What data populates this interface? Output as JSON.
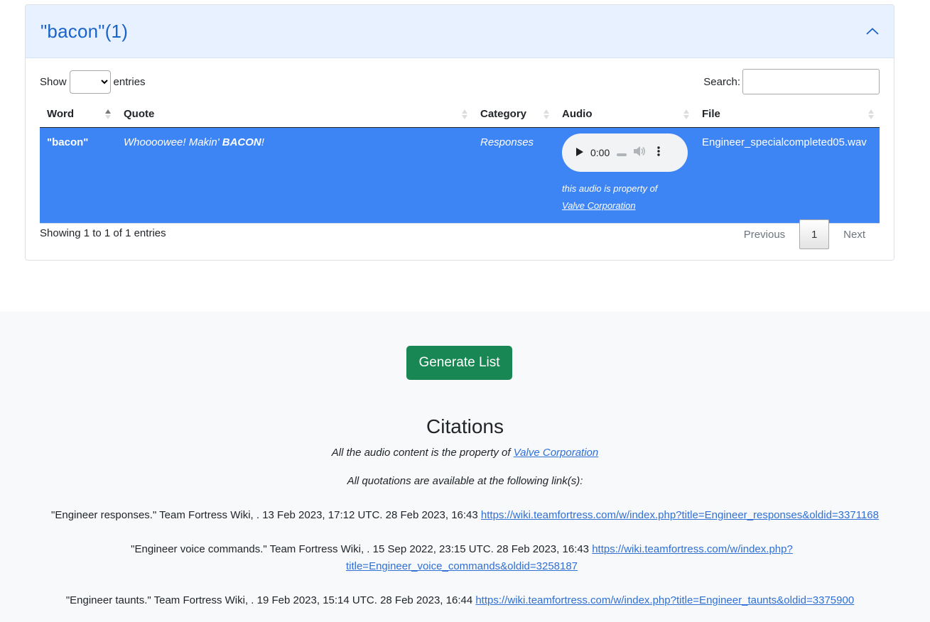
{
  "card": {
    "title": "\"bacon\"(1)",
    "length_show": "Show",
    "length_entries": "entries",
    "search_label": "Search:",
    "columns": [
      "Word",
      "Quote",
      "Category",
      "Audio",
      "File"
    ],
    "row": {
      "word": "\"bacon\"",
      "quote_pre": "Whoooowee! Makin' ",
      "quote_bold": "BACON",
      "quote_post": "!",
      "category": "Responses",
      "audio_time": "0:00",
      "audio_note": "this audio is property of",
      "audio_owner": "Valve Corporation",
      "file": "Engineer_specialcompleted05.wav"
    },
    "info": "Showing 1 to 1 of 1 entries",
    "pager": {
      "prev": "Previous",
      "current": "1",
      "next": "Next"
    }
  },
  "footer": {
    "button": "Generate List",
    "title": "Citations",
    "property_text": "All the audio content is the property of ",
    "property_link": "Valve Corporation",
    "quotations_text": "All quotations are available at the following link(s):",
    "citations": [
      {
        "text": "\"Engineer responses.\" Team Fortress Wiki, . 13 Feb 2023, 17:12 UTC. 28 Feb 2023, 16:43 ",
        "link": "https://wiki.teamfortress.com/w/index.php?title=Engineer_responses&oldid=3371168"
      },
      {
        "text": "\"Engineer voice commands.\" Team Fortress Wiki, . 15 Sep 2022, 23:15 UTC. 28 Feb 2023, 16:43 ",
        "link_a": "https://wiki.teamfortress.com/w/index.php?",
        "link_b": "title=Engineer_voice_commands&oldid=3258187"
      },
      {
        "text": "\"Engineer taunts.\" Team Fortress Wiki, . 19 Feb 2023, 15:14 UTC. 28 Feb 2023, 16:44 ",
        "link": "https://wiki.teamfortress.com/w/index.php?title=Engineer_taunts&oldid=3375900"
      }
    ]
  },
  "colors": {
    "selected_row": "#3d84f5",
    "button": "#198754",
    "header_bg": "#e7f1ff",
    "title_blue": "#1a63c9"
  }
}
